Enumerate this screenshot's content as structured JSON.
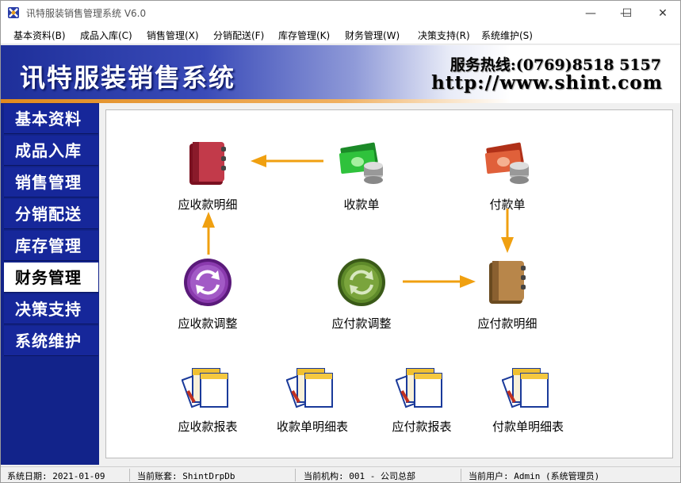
{
  "window": {
    "title": "讯特服装销售管理系统 V6.0",
    "minimize": "—",
    "maximize": "☐",
    "close": "✕"
  },
  "menu": [
    "基本资料(B)",
    "成品入库(C)",
    "销售管理(X)",
    "分销配送(F)",
    "库存管理(K)",
    "财务管理(W)",
    "决策支持(R)",
    "系统维护(S)"
  ],
  "banner": {
    "title": "讯特服装销售系统",
    "hotline": "服务热线:(0769)8518 5157",
    "url": "http://www.shint.com"
  },
  "sidebar": {
    "items": [
      {
        "label": "基本资料"
      },
      {
        "label": "成品入库"
      },
      {
        "label": "销售管理"
      },
      {
        "label": "分销配送"
      },
      {
        "label": "库存管理"
      },
      {
        "label": "财务管理",
        "active": true
      },
      {
        "label": "决策支持"
      },
      {
        "label": "系统维护"
      }
    ]
  },
  "finance": {
    "receivable_detail": "应收款明细",
    "receipt": "收款单",
    "payment": "付款单",
    "receivable_adjust": "应收款调整",
    "payable_adjust": "应付款调整",
    "payable_detail": "应付款明细",
    "receivable_report": "应收款报表",
    "receipt_detail_report": "收款单明细表",
    "payable_report": "应付款报表",
    "payment_detail_report": "付款单明细表"
  },
  "colors": {
    "sidebar": "#12238a",
    "arrow": "#f0a010",
    "banner_start": "#1e2f9a",
    "stripe": "#e08a1e"
  },
  "status": {
    "date": "系统日期: 2021-01-09",
    "account": "当前账套: ShintDrpDb",
    "org": "当前机构: 001 - 公司总部",
    "user": "当前用户: Admin (系统管理员)"
  }
}
